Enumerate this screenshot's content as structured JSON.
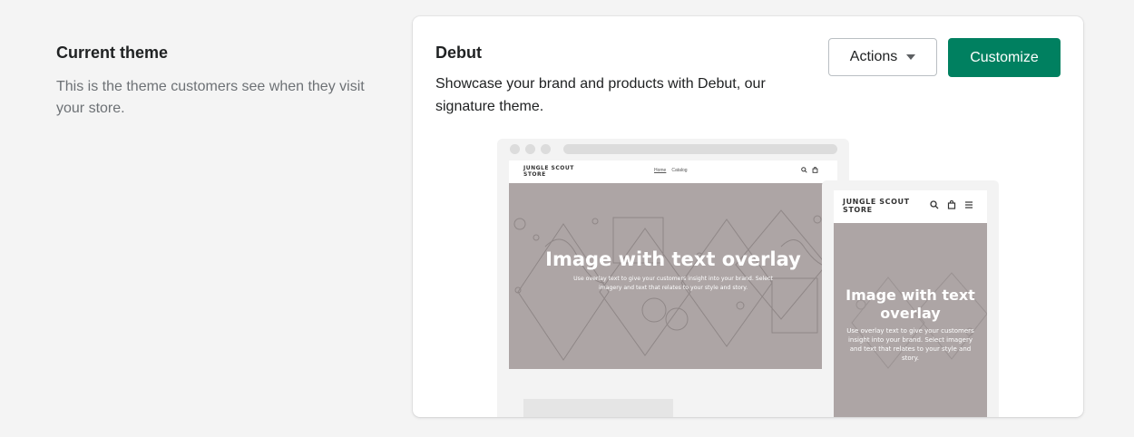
{
  "section": {
    "title": "Current theme",
    "description": "This is the theme customers see when they visit your store."
  },
  "theme_card": {
    "name": "Debut",
    "description": "Showcase your brand and products with Debut, our signature theme.",
    "actions_label": "Actions",
    "customize_label": "Customize",
    "accent_color": "#008060"
  },
  "preview": {
    "store_name": "JUNGLE SCOUT STORE",
    "nav_links": [
      "Home",
      "Catalog"
    ],
    "hero_title": "Image with text overlay",
    "hero_subtitle": "Use overlay text to give your customers insight into your brand. Select imagery and text that relates to your style and story.",
    "hero_color": "#ada5a5",
    "icons": [
      "search-icon",
      "cart-icon",
      "menu-icon"
    ]
  }
}
